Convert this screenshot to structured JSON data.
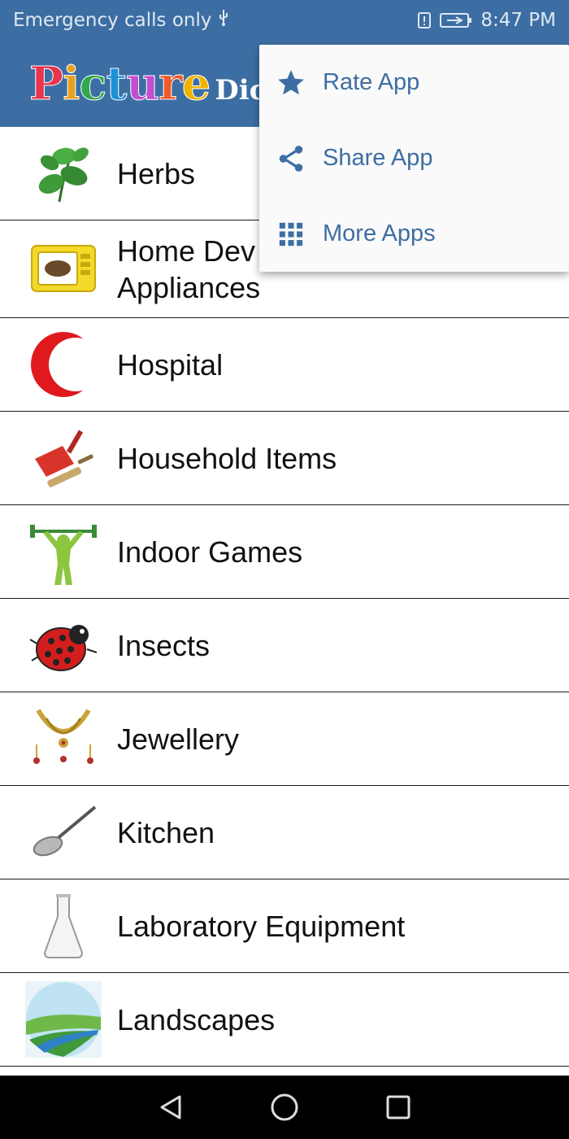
{
  "status_bar": {
    "carrier": "Emergency calls only",
    "time": "8:47 PM"
  },
  "app_bar": {
    "logo_big": "Picture",
    "logo_small": "Dicti",
    "logo_letter_colors": [
      "#e8344d",
      "#e8a11c",
      "#2fa84f",
      "#1e90d6",
      "#c04fd1",
      "#f05a28",
      "#f0b400"
    ]
  },
  "categories": [
    {
      "label": "Herbs",
      "icon": "herb-leaves-icon"
    },
    {
      "label": "Home Devices & Appliances",
      "line1": "Home Dev",
      "line2": "Appliances",
      "icon": "microwave-icon"
    },
    {
      "label": "Hospital",
      "icon": "red-crescent-icon"
    },
    {
      "label": "Household Items",
      "icon": "dustpan-brush-icon"
    },
    {
      "label": "Indoor Games",
      "icon": "weightlifter-icon"
    },
    {
      "label": "Insects",
      "icon": "ladybug-icon"
    },
    {
      "label": "Jewellery",
      "icon": "necklace-icon"
    },
    {
      "label": "Kitchen",
      "icon": "ladle-icon"
    },
    {
      "label": "Laboratory Equipment",
      "icon": "flask-icon"
    },
    {
      "label": "Landscapes",
      "icon": "landscape-icon"
    }
  ],
  "overflow_menu": {
    "items": [
      {
        "label": "Rate App",
        "icon": "star-icon"
      },
      {
        "label": "Share App",
        "icon": "share-icon"
      },
      {
        "label": "More Apps",
        "icon": "grid-icon"
      }
    ]
  },
  "colors": {
    "primary": "#3d6ea3",
    "menu_text": "#3d6ea3",
    "divider": "#1a1a1a"
  }
}
